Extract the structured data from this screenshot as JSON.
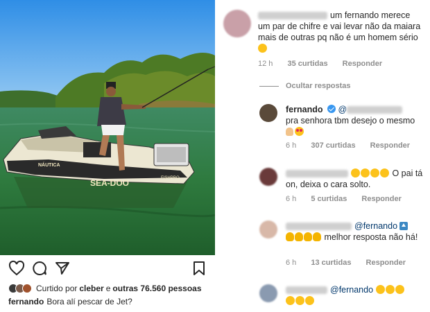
{
  "post": {
    "liked_by_prefix": "Curtido por",
    "liked_by_user": "cleber",
    "liked_by_and": "e",
    "liked_by_others": "outras 76.560 pessoas",
    "caption_user": "fernando",
    "caption_text": "Bora alí pescar de Jet?",
    "jetski_brand": "SEA-DOO",
    "jetski_side": "FISHPRO",
    "jetski_label": "NÁUTICA",
    "icons": [
      "heart-icon",
      "comment-icon",
      "share-icon",
      "bookmark-icon"
    ]
  },
  "comments": {
    "c1": {
      "text": "um fernando merece um par de chifre e vai levar não  da maiara mais de outras pq não é um homem sério",
      "time": "12 h",
      "likes": "35 curtidas",
      "reply": "Responder"
    },
    "hide_replies": "Ocultar respostas",
    "c2": {
      "user": "fernando",
      "mention": "@",
      "text": "pra senhora tbm desejo o mesmo",
      "time": "6 h",
      "likes": "307 curtidas",
      "reply": "Responder"
    },
    "c3": {
      "text": "O pai tá on, deixa o cara solto.",
      "time": "6 h",
      "likes": "5 curtidas",
      "reply": "Responder"
    },
    "c4": {
      "mention": "@fernando",
      "text": "melhor resposta não há!",
      "time": "6 h",
      "likes": "13 curtidas",
      "reply": "Responder"
    },
    "c5": {
      "mention": "@fernando"
    }
  },
  "colors": {
    "mention": "#00376b",
    "muted": "#8e8e8e",
    "verified": "#3897f0",
    "text": "#262626"
  }
}
